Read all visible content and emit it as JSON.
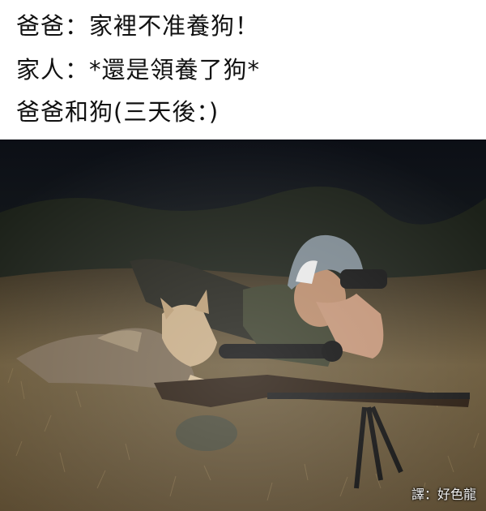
{
  "caption": {
    "line1": "爸爸：家裡不准養狗！",
    "line2": "家人：*還是領養了狗*",
    "line3": "爸爸和狗(三天後：)"
  },
  "photo": {
    "credit": "譯：好色龍",
    "subjects": [
      "man-with-binoculars",
      "coyote",
      "rifle-with-scope",
      "bipod"
    ]
  }
}
